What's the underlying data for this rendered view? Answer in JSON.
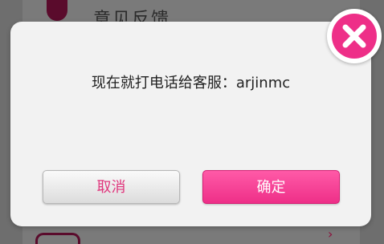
{
  "background": {
    "row_1_label": "意见反馈",
    "row_2_mark": "›"
  },
  "dialog": {
    "message": "现在就打电话给客服：arjinmc",
    "cancel_label": "取消",
    "confirm_label": "确定"
  },
  "icons": {
    "close": "close-icon"
  },
  "colors": {
    "accent": "#ee2f88",
    "dialog_bg": "#f2f2f2",
    "overlay": "#6e6e6e"
  }
}
